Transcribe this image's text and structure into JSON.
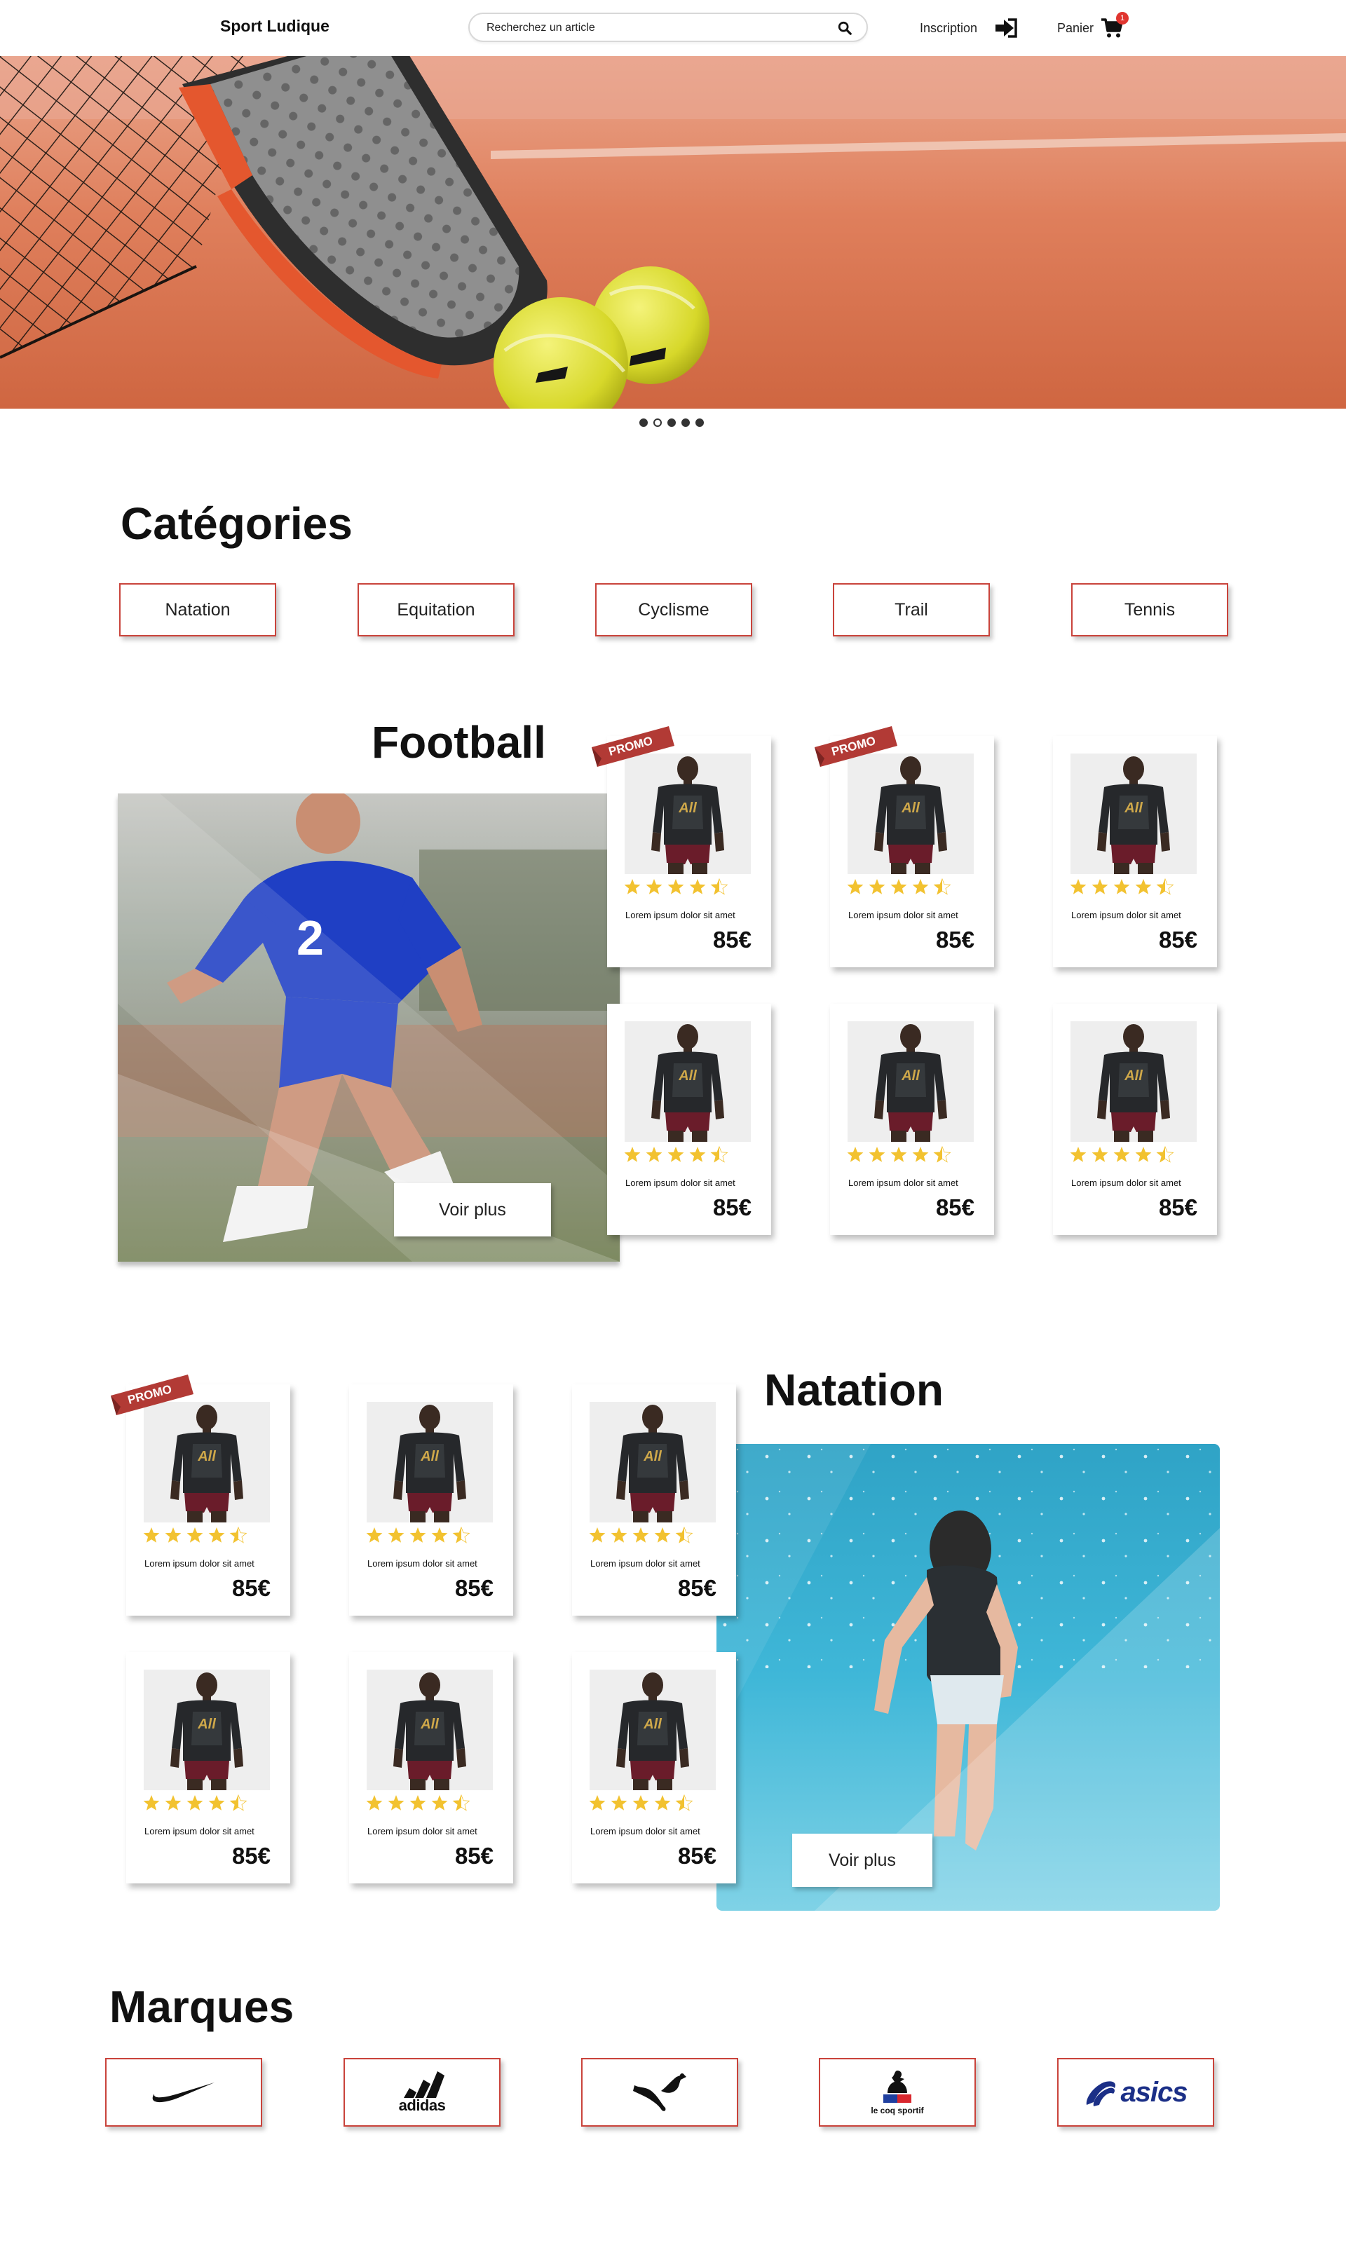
{
  "header": {
    "brand": "Sport Ludique",
    "search_placeholder": "Recherchez un article",
    "signup_label": "Inscription",
    "cart_label": "Panier",
    "cart_count": "1"
  },
  "hero": {
    "slides_total": 5,
    "active_slide": 2
  },
  "categories": {
    "title": "Catégories",
    "items": [
      "Natation",
      "Equitation",
      "Cyclisme",
      "Trail",
      "Tennis"
    ]
  },
  "product": {
    "description": "Lorem ipsum dolor sit amet",
    "price": "85€",
    "rating": 4.5,
    "rating_max": 5,
    "shirt_print": "All",
    "promo_label": "PROMO"
  },
  "football": {
    "title": "Football",
    "see_more": "Voir plus",
    "jersey_number": "2",
    "cards": [
      {
        "promo": true
      },
      {
        "promo": true
      },
      {
        "promo": false
      },
      {
        "promo": false
      },
      {
        "promo": false
      },
      {
        "promo": false
      }
    ]
  },
  "natation": {
    "title": "Natation",
    "see_more": "Voir plus",
    "cards": [
      {
        "promo": true
      },
      {
        "promo": false
      },
      {
        "promo": false
      },
      {
        "promo": false
      },
      {
        "promo": false
      },
      {
        "promo": false
      }
    ]
  },
  "brands": {
    "title": "Marques",
    "items": [
      {
        "name": "nike",
        "icon": "nike-swoosh-logo"
      },
      {
        "name": "adidas",
        "icon": "adidas-logo"
      },
      {
        "name": "puma",
        "icon": "puma-cat-logo"
      },
      {
        "name": "le coq sportif",
        "icon": "le-coq-sportif-logo"
      },
      {
        "name": "asics",
        "icon": "asics-logo"
      }
    ]
  },
  "colors": {
    "accent": "#c9433b",
    "promo": "#b23a35",
    "star": "#f2c230",
    "badge": "#e0352f"
  }
}
